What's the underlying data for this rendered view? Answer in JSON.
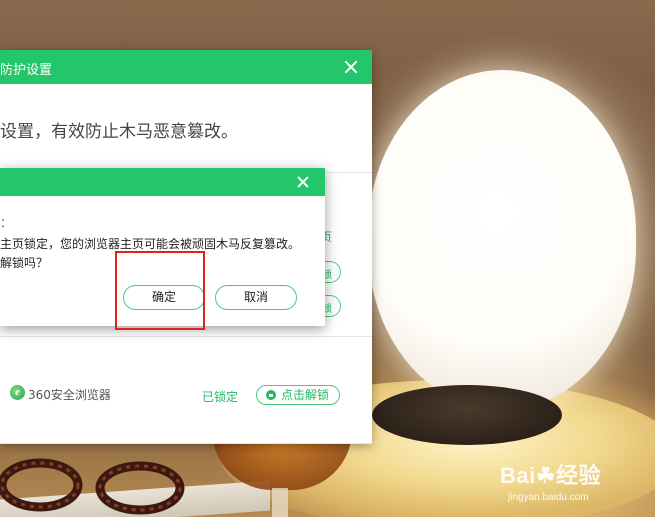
{
  "main_window": {
    "title": "防护设置",
    "description": "设置，有效防止木马恶意篡改。",
    "partial_link": "页",
    "partial_btn_1": "锁",
    "partial_btn_2": "锁",
    "browser_row": {
      "browser_icon": "360-browser-icon",
      "browser_name": "360安全浏览器",
      "status": "已锁定",
      "unlock_label": "点击解锁"
    }
  },
  "confirm_dialog": {
    "warn_prefix": "：",
    "message_line_1": "主页锁定，您的浏览器主页可能会被顽固木马反复篡改。",
    "message_line_2": "解锁吗？",
    "ok_label": "确定",
    "cancel_label": "取消"
  },
  "watermark": {
    "logo": "Bai",
    "logo_suffix": "经验",
    "url": "jingyan.baidu.com"
  },
  "colors": {
    "title_bar": "#23c66a",
    "accent_green": "#23b864",
    "highlight_red": "#e2231a"
  }
}
